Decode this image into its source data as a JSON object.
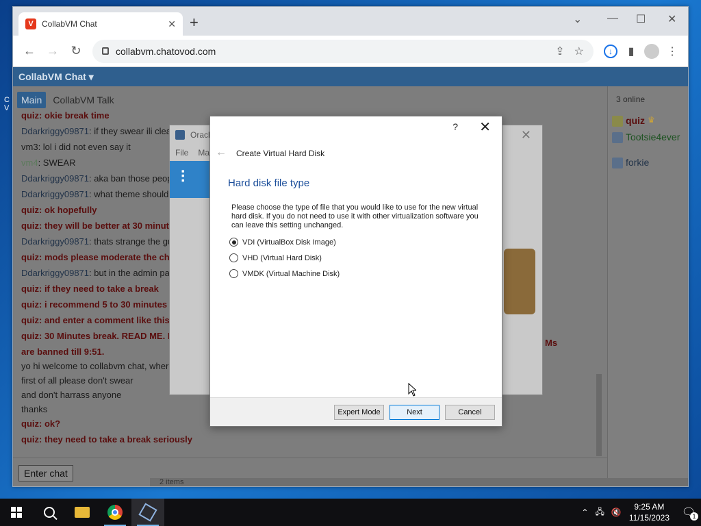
{
  "browser": {
    "tab_title": "CollabVM Chat",
    "tab_icon": "collabvm-favicon",
    "url": "collabvm.chatovod.com"
  },
  "chat": {
    "header": "CollabVM Chat ▾",
    "tabs": [
      "Main",
      "CollabVM Talk"
    ],
    "messages": [
      {
        "user": "quiz",
        "text": ": okie break time"
      },
      {
        "user": "Ddarkriggy09871",
        "text": ": if they swear ili clea"
      },
      {
        "user": "vm3",
        "text": ": lol i did not even say it"
      },
      {
        "user": "vm4",
        "text": ": SWEAR"
      },
      {
        "user": "Ddarkriggy09871",
        "text": ": aka ban those peop"
      },
      {
        "user": "Ddarkriggy09871",
        "text": ": what theme should"
      },
      {
        "user": "quiz",
        "text": ": ok hopefully"
      },
      {
        "user": "quiz",
        "text": ": they will be better at 30 minute"
      },
      {
        "user": "Ddarkriggy09871",
        "text": ": thats strange the gu"
      },
      {
        "user": "quiz",
        "text": ": mods please moderate the ch"
      },
      {
        "user": "Ddarkriggy09871",
        "text": ": but in the admin pa"
      },
      {
        "user": "quiz",
        "text": ": if they need to take a break"
      },
      {
        "user": "quiz",
        "text": ": i recommend 5 to 30 minutes"
      },
      {
        "user": "quiz",
        "text": ": and enter a comment like this"
      },
      {
        "user": "quiz",
        "text": ": 30 Minutes break. READ ME. I"
      },
      {
        "user": "",
        "text": "are banned till 9:51."
      },
      {
        "user": "",
        "text": "yo hi welcome to collabvm chat, wher"
      },
      {
        "user": "",
        "text": "first of all please don't swear"
      },
      {
        "user": "",
        "text": "and don't harrass anyone"
      },
      {
        "user": "",
        "text": "thanks"
      },
      {
        "user": "quiz",
        "text": ": ok?"
      },
      {
        "user": "quiz",
        "text": ": they need to take a break seriously"
      }
    ],
    "overflow_text": "Ms",
    "enter_chat": "Enter chat",
    "online_count": "3 online",
    "users": [
      "quiz",
      "Tootsie4ever",
      "forkie"
    ],
    "status_bar_text": "2 items"
  },
  "vbox_window": {
    "title": "Oracl",
    "menu": [
      "File",
      "Ma"
    ]
  },
  "dialog": {
    "help": "?",
    "title": "Create Virtual Hard Disk",
    "heading": "Hard disk file type",
    "description": "Please choose the type of file that you would like to use for the new virtual hard disk. If you do not need to use it with other virtualization software you can leave this setting unchanged.",
    "options": [
      {
        "label": "VDI (VirtualBox Disk Image)",
        "checked": true
      },
      {
        "label": "VHD (Virtual Hard Disk)",
        "checked": false
      },
      {
        "label": "VMDK (Virtual Machine Disk)",
        "checked": false
      }
    ],
    "buttons": {
      "expert": "Expert Mode",
      "next": "Next",
      "cancel": "Cancel"
    }
  },
  "taskbar": {
    "time": "9:25 AM",
    "date": "11/15/2023",
    "notification_count": "1"
  },
  "colors": {
    "accent": "#2f5f8e",
    "dialog_heading": "#1b4e9a",
    "quiz_user": "#5a0e0e"
  }
}
